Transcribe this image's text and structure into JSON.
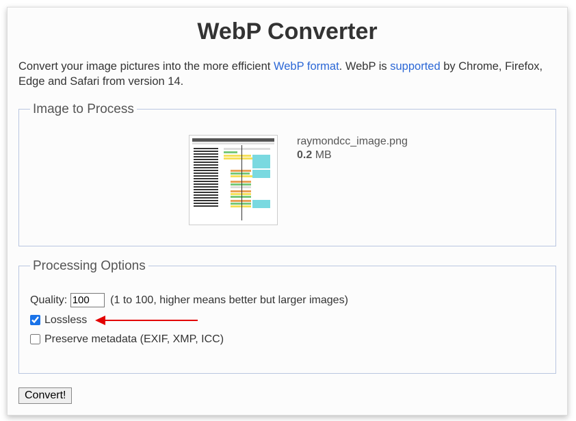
{
  "header": {
    "title": "WebP Converter"
  },
  "intro": {
    "text_before": "Convert your image pictures into the more efficient ",
    "link1_text": "WebP format",
    "text_mid": ". WebP is ",
    "link2_text": "supported",
    "text_after": " by Chrome, Firefox, Edge and Safari from version 14."
  },
  "image_section": {
    "legend": "Image to Process",
    "filename": "raymondcc_image.png",
    "filesize": "0.2",
    "filesize_unit": " MB"
  },
  "options_section": {
    "legend": "Processing Options",
    "quality_label": "Quality:",
    "quality_value": "100",
    "quality_hint": "(1 to 100, higher means better but larger images)",
    "lossless_label": "Lossless",
    "lossless_checked": true,
    "metadata_label": "Preserve metadata (EXIF, XMP, ICC)",
    "metadata_checked": false
  },
  "buttons": {
    "convert": "Convert!"
  }
}
